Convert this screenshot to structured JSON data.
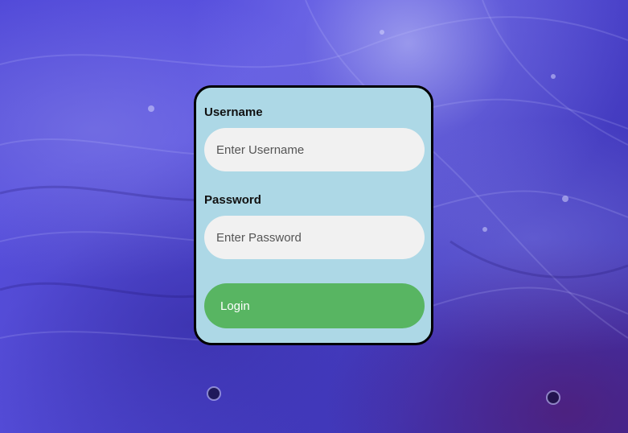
{
  "colors": {
    "background": "#4f47d6",
    "card_background": "#add8e6",
    "card_border": "#000000",
    "input_background": "#f1f1f1",
    "button_background": "#58b562",
    "button_text": "#ffffff"
  },
  "login_form": {
    "username_label": "Username",
    "username_placeholder": "Enter Username",
    "username_value": "",
    "password_label": "Password",
    "password_placeholder": "Enter Password",
    "password_value": "",
    "login_button_label": "Login"
  }
}
